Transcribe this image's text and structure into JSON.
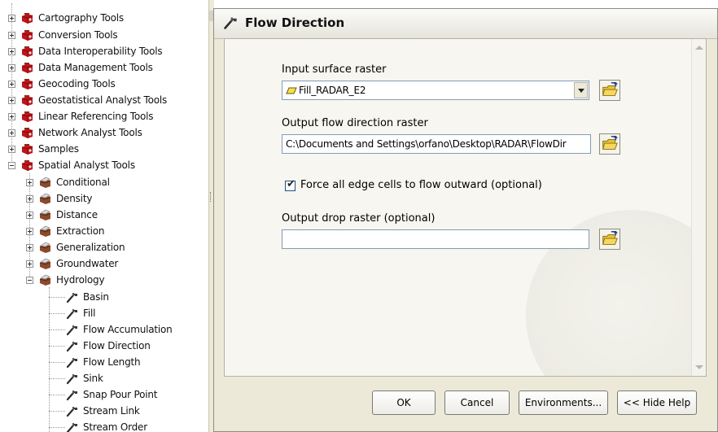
{
  "toolbox": {
    "items": [
      {
        "label": "Cartography Tools"
      },
      {
        "label": "Conversion Tools"
      },
      {
        "label": "Data Interoperability Tools"
      },
      {
        "label": "Data Management Tools"
      },
      {
        "label": "Geocoding Tools"
      },
      {
        "label": "Geostatistical Analyst Tools"
      },
      {
        "label": "Linear Referencing Tools"
      },
      {
        "label": "Network Analyst Tools"
      },
      {
        "label": "Samples"
      },
      {
        "label": "Spatial Analyst Tools"
      }
    ],
    "spatial_children": [
      {
        "label": "Conditional"
      },
      {
        "label": "Density"
      },
      {
        "label": "Distance"
      },
      {
        "label": "Extraction"
      },
      {
        "label": "Generalization"
      },
      {
        "label": "Groundwater"
      },
      {
        "label": "Hydrology"
      }
    ],
    "hydrology_tools": [
      {
        "label": "Basin"
      },
      {
        "label": "Fill"
      },
      {
        "label": "Flow Accumulation"
      },
      {
        "label": "Flow Direction"
      },
      {
        "label": "Flow Length"
      },
      {
        "label": "Sink"
      },
      {
        "label": "Snap Pour Point"
      },
      {
        "label": "Stream Link"
      },
      {
        "label": "Stream Order"
      }
    ]
  },
  "dialog": {
    "title": "Flow Direction",
    "input_label": "Input surface raster",
    "input_value": "Fill_RADAR_E2",
    "output_label": "Output flow direction raster",
    "output_value": "C:\\Documents and Settings\\orfano\\Desktop\\RADAR\\FlowDir",
    "force_label": "Force all edge cells to flow outward (optional)",
    "force_checked": true,
    "drop_label": "Output drop raster (optional)",
    "drop_value": "",
    "buttons": {
      "ok": "OK",
      "cancel": "Cancel",
      "environments": "Environments...",
      "hide_help": "<< Hide Help"
    }
  },
  "icons": {
    "toolbox": "toolbox-icon",
    "toolset": "toolset-icon",
    "tool": "hammer-icon",
    "raster_layer": "raster-layer-icon",
    "browse": "open-folder-icon"
  },
  "colors": {
    "toolbox_red": "#c0141a",
    "dialog_bg": "#ece9d8",
    "panel_bg": "#f7f6f0",
    "field_border": "#7f9db9"
  }
}
